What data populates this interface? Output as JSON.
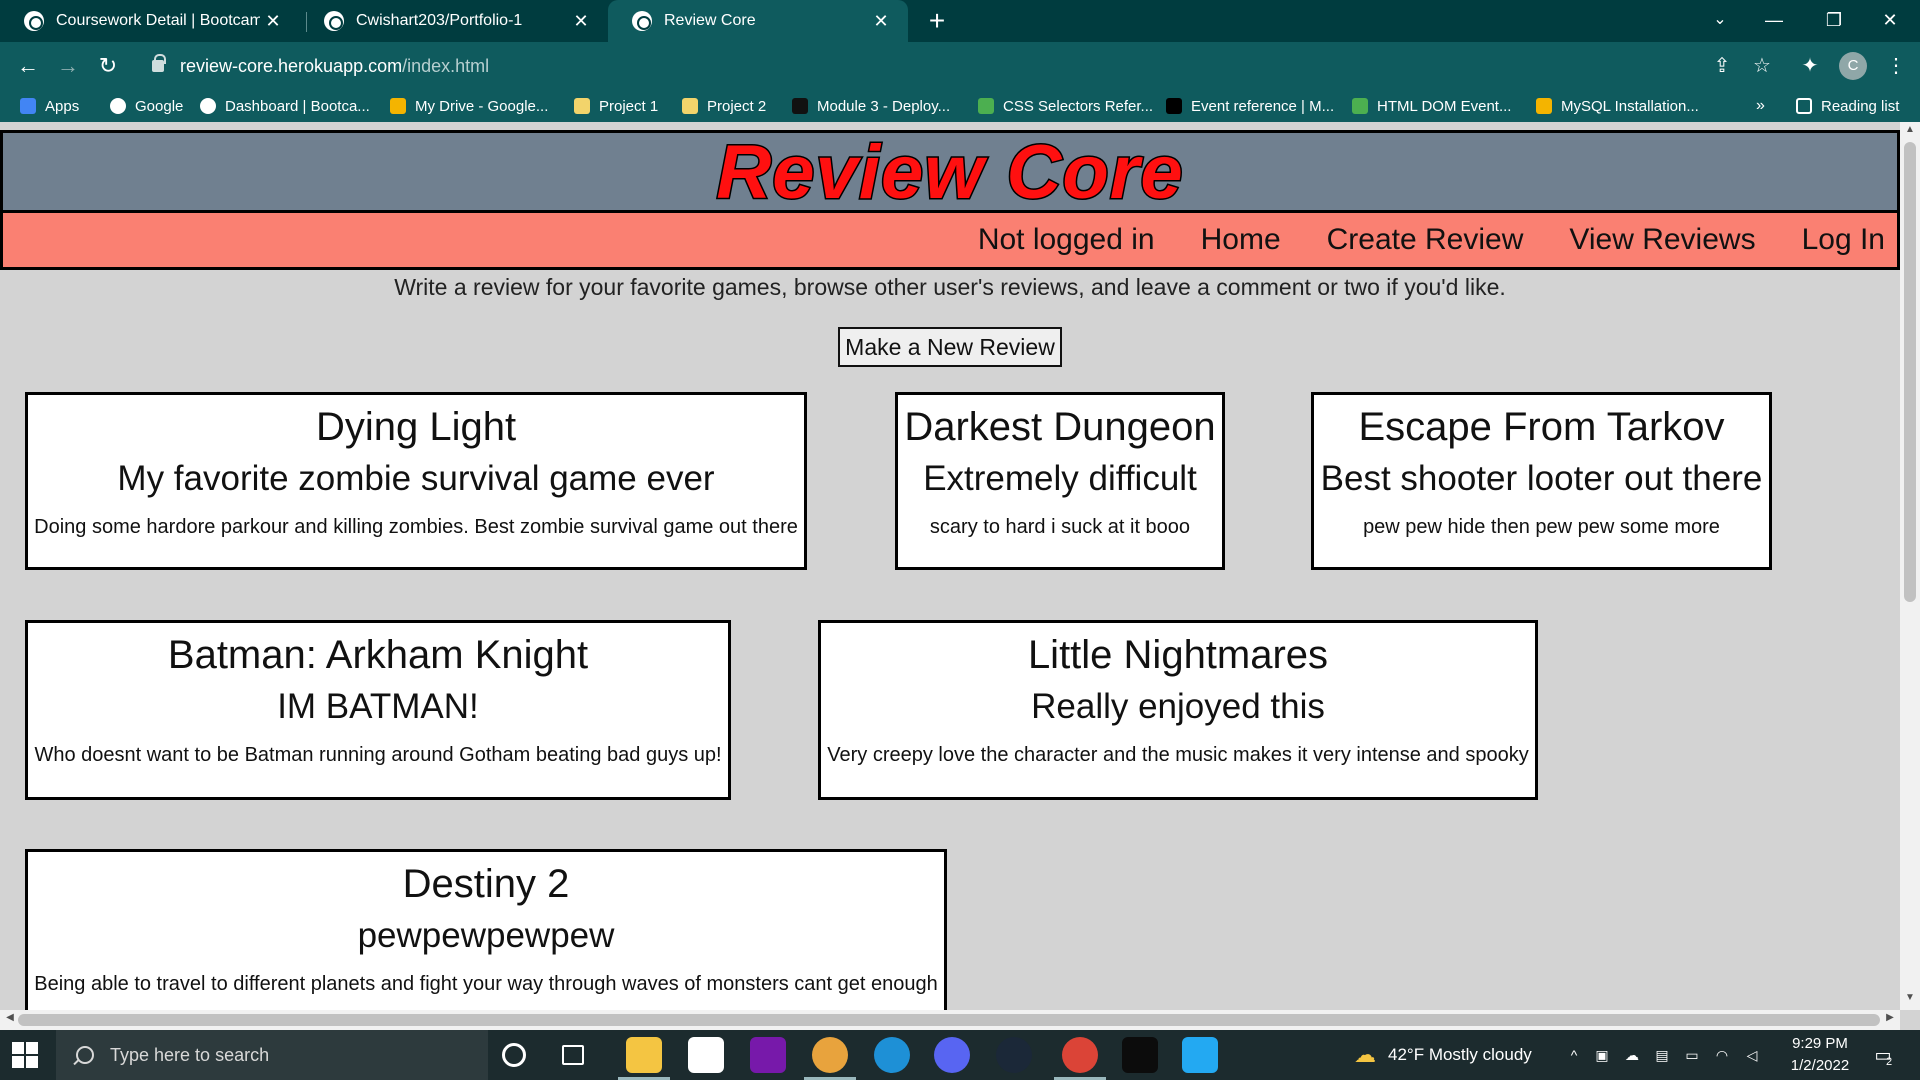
{
  "browser": {
    "tabs": [
      {
        "title": "Coursework Detail | Bootcamp Sp",
        "active": false
      },
      {
        "title": "Cwishart203/Portfolio-1",
        "active": false
      },
      {
        "title": "Review Core",
        "active": true
      }
    ],
    "close_glyph": "✕",
    "new_tab_glyph": "+",
    "url_host": "review-core.herokuapp.com",
    "url_path": "/index.html",
    "profile_initial": "C",
    "bookmarks": [
      {
        "label": "Apps",
        "icon": "apps-grid-icon",
        "color": "#4285f4"
      },
      {
        "label": "Google",
        "icon": "google-icon",
        "color": "#ffffff"
      },
      {
        "label": "Dashboard | Bootca...",
        "icon": "globe-icon",
        "color": "#ffffff"
      },
      {
        "label": "My Drive - Google...",
        "icon": "google-drive-icon",
        "color": "#f4b400"
      },
      {
        "label": "Project 1",
        "icon": "folder-icon",
        "color": "#f2d46b"
      },
      {
        "label": "Project 2",
        "icon": "folder-icon",
        "color": "#f2d46b"
      },
      {
        "label": "Module 3 - Deploy...",
        "icon": "notebook-icon",
        "color": "#111111"
      },
      {
        "label": "CSS Selectors Refer...",
        "icon": "w3schools-icon",
        "color": "#4caf50"
      },
      {
        "label": "Event reference | M...",
        "icon": "mdn-icon",
        "color": "#000000"
      },
      {
        "label": "HTML DOM Event...",
        "icon": "w3schools-icon",
        "color": "#4caf50"
      },
      {
        "label": "MySQL Installation...",
        "icon": "fs-icon",
        "color": "#f4b400"
      }
    ],
    "bookmarks_more": "»",
    "reading_list": "Reading list"
  },
  "site": {
    "title": "Review Core",
    "nav": [
      "Not logged in",
      "Home",
      "Create Review",
      "View Reviews",
      "Log In"
    ],
    "intro": "Write a review for your favorite games, browse other user's reviews, and leave a comment or two if you'd like.",
    "new_review_button": "Make a New Review",
    "reviews": [
      {
        "title": "Dying Light",
        "subtitle": "My favorite zombie survival game ever",
        "body": "Doing some hardore parkour and killing zombies. Best zombie survival game out there"
      },
      {
        "title": "Darkest Dungeon",
        "subtitle": "Extremely difficult",
        "body": "scary to hard i suck at it booo"
      },
      {
        "title": "Escape From Tarkov",
        "subtitle": "Best shooter looter out there",
        "body": "pew pew hide then pew pew some more"
      },
      {
        "title": "Batman: Arkham Knight",
        "subtitle": "IM BATMAN!",
        "body": "Who doesnt want to be Batman running around Gotham beating bad guys up!"
      },
      {
        "title": "Little Nightmares",
        "subtitle": "Really enjoyed this",
        "body": "Very creepy love the character and the music makes it very intense and spooky"
      },
      {
        "title": "Destiny 2",
        "subtitle": "pewpewpewpew",
        "body": "Being able to travel to different planets and fight your way through waves of monsters cant get enough"
      }
    ]
  },
  "taskbar": {
    "search_placeholder": "Type here to search",
    "weather": "42°F  Mostly cloudy",
    "time": "9:29 PM",
    "date": "1/2/2022",
    "notification_count": "2",
    "apps": [
      {
        "icon": "cortana-icon",
        "color": "#1c2b2e"
      },
      {
        "icon": "task-view-icon",
        "color": "#1c2b2e"
      },
      {
        "icon": "file-explorer-icon",
        "color": "#f4c542"
      },
      {
        "icon": "microsoft-store-icon",
        "color": "#ffffff"
      },
      {
        "icon": "onenote-icon",
        "color": "#7719aa"
      },
      {
        "icon": "chrome-canary-icon",
        "color": "#e8a33d"
      },
      {
        "icon": "edge-icon",
        "color": "#1e90d6"
      },
      {
        "icon": "discord-icon",
        "color": "#5865f2"
      },
      {
        "icon": "steam-icon",
        "color": "#1b2838"
      },
      {
        "icon": "chrome-icon",
        "color": "#db4437"
      },
      {
        "icon": "terminal-icon",
        "color": "#0c0c0c"
      },
      {
        "icon": "vscode-icon",
        "color": "#23a9f2"
      }
    ]
  }
}
